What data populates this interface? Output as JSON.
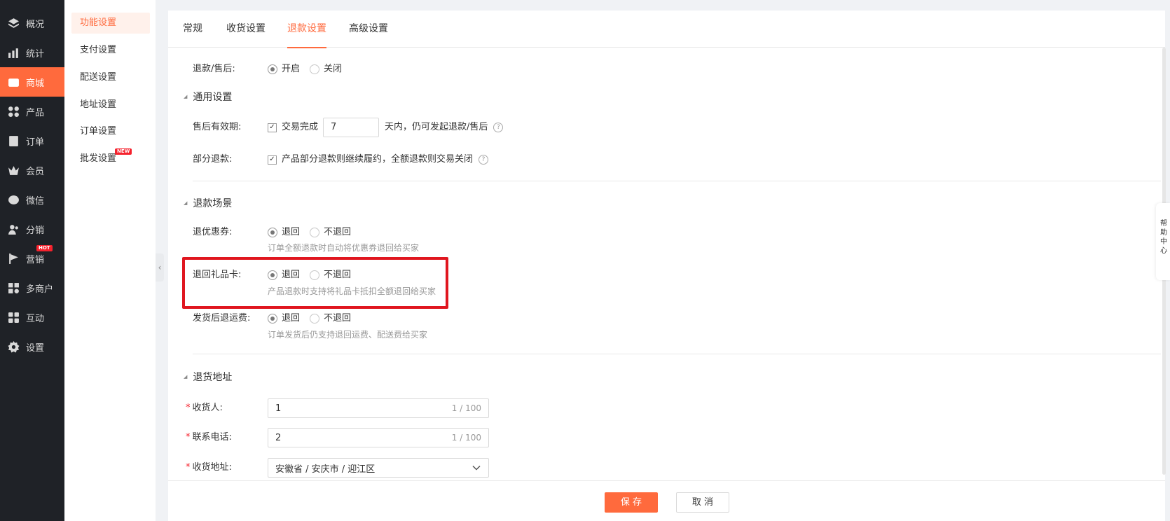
{
  "nav": {
    "items": [
      {
        "label": "概况",
        "icon": "layers-icon"
      },
      {
        "label": "统计",
        "icon": "chart-icon"
      },
      {
        "label": "商城",
        "icon": "store-icon"
      },
      {
        "label": "产品",
        "icon": "grid-icon"
      },
      {
        "label": "订单",
        "icon": "order-icon"
      },
      {
        "label": "会员",
        "icon": "crown-icon"
      },
      {
        "label": "微信",
        "icon": "wechat-icon"
      },
      {
        "label": "分销",
        "icon": "users-icon"
      },
      {
        "label": "营销",
        "icon": "flag-icon",
        "badge": "HOT"
      },
      {
        "label": "多商户",
        "icon": "merchant-icon"
      },
      {
        "label": "互动",
        "icon": "interact-icon"
      },
      {
        "label": "设置",
        "icon": "gear-icon"
      }
    ],
    "active": "商城"
  },
  "subnav": {
    "items": [
      {
        "label": "功能设置"
      },
      {
        "label": "支付设置"
      },
      {
        "label": "配送设置"
      },
      {
        "label": "地址设置"
      },
      {
        "label": "订单设置"
      },
      {
        "label": "批发设置",
        "badge": "NEW"
      }
    ],
    "active": "功能设置"
  },
  "tabs": [
    {
      "label": "常规"
    },
    {
      "label": "收货设置"
    },
    {
      "label": "退款设置"
    },
    {
      "label": "高级设置"
    }
  ],
  "active_tab": "退款设置",
  "form": {
    "refund": {
      "label": "退款/售后:",
      "on": "开启",
      "off": "关闭"
    },
    "general": {
      "title": "通用设置"
    },
    "period": {
      "label": "售后有效期:",
      "check": "交易完成",
      "value": "7",
      "suffix": "天内，仍可发起退款/售后"
    },
    "partial": {
      "label": "部分退款:",
      "check": "产品部分退款则继续履约，全额退款则交易关闭"
    },
    "scene": {
      "title": "退款场景"
    },
    "coupon": {
      "label": "退优惠券:",
      "yes": "退回",
      "no": "不退回",
      "hint": "订单全额退款时自动将优惠券退回给买家"
    },
    "giftcard": {
      "label": "退回礼品卡:",
      "yes": "退回",
      "no": "不退回",
      "hint": "产品退款时支持将礼品卡抵扣全额退回给买家"
    },
    "shipping": {
      "label": "发货后退运费:",
      "yes": "退回",
      "no": "不退回",
      "hint": "订单发货后仍支持退回运费、配送费给买家"
    },
    "address": {
      "title": "退货地址"
    },
    "receiver": {
      "label": "收货人:",
      "value": "1",
      "count": "1 / 100"
    },
    "phone": {
      "label": "联系电话:",
      "value": "2",
      "count": "1 / 100"
    },
    "region": {
      "label": "收货地址:",
      "value": "安徽省 / 安庆市 / 迎江区"
    }
  },
  "footer": {
    "save": "保 存",
    "cancel": "取 消"
  },
  "help_tab": "帮助中心",
  "colors": {
    "accent": "#ff6a3d",
    "nav_bg": "#1f2227",
    "highlight": "#e0161f"
  }
}
